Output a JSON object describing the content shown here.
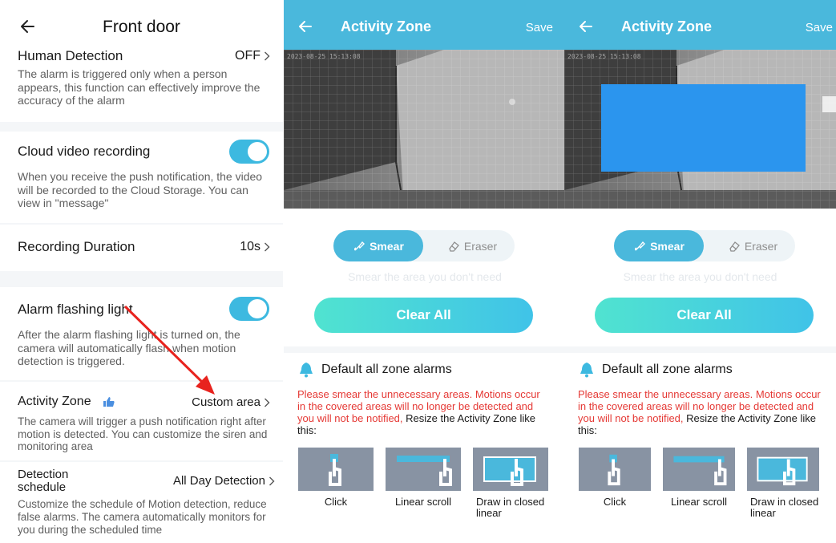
{
  "panel1": {
    "title": "Front door",
    "human_detection": {
      "label": "Human Detection",
      "value": "OFF",
      "desc": "The alarm is triggered only when a person appears, this function can effectively improve the accuracy of the alarm"
    },
    "cloud_recording": {
      "label": "Cloud video recording",
      "enabled": true,
      "desc": "When you receive the push notification, the video will be recorded to the Cloud Storage. You can view in \"message\""
    },
    "recording_duration": {
      "label": "Recording Duration",
      "value": "10s"
    },
    "alarm_light": {
      "label": "Alarm flashing light",
      "enabled": true,
      "desc": "After the alarm flashing light is turned on, the camera will automatically flash when motion detection is triggered."
    },
    "activity_zone": {
      "label": "Activity Zone",
      "value": "Custom area",
      "desc": "The camera will trigger a push notification right after motion is detected. You can customize the siren and monitoring area"
    },
    "detection_schedule": {
      "label_line1": "Detection",
      "label_line2": "schedule",
      "value": "All Day Detection",
      "desc": "Customize the schedule of Motion detection, reduce false alarms. The camera automatically monitors for you during the scheduled time"
    }
  },
  "zone_panels": [
    {
      "title": "Activity Zone",
      "save": "Save",
      "timestamp": "2023-08-25 15:13:08",
      "smear": "Smear",
      "eraser": "Eraser",
      "hint": "Smear the area you don't need",
      "clear_all": "Clear All",
      "alarm_text": "Default all zone alarms",
      "warning_red": "Please smear the unnecessary areas. Motions occur in the covered areas will no longer be detected and you will not be notified,",
      "warning_black": " Resize the Activity Zone like this:",
      "examples": [
        "Click",
        "Linear scroll",
        "Draw in closed linear"
      ]
    },
    {
      "title": "Activity Zone",
      "save": "Save",
      "timestamp": "2023-08-25 15:13:08",
      "smear": "Smear",
      "eraser": "Eraser",
      "hint": "Smear the area you don't need",
      "clear_all": "Clear All",
      "alarm_text": "Default all zone alarms",
      "warning_red": "Please smear the unnecessary areas. Motions occur in the covered areas will no longer be detected and you will not be notified,",
      "warning_black": " Resize the Activity Zone like this:",
      "examples": [
        "Click",
        "Linear scroll",
        "Draw in closed linear"
      ]
    }
  ],
  "colors": {
    "accent": "#4ab8dc",
    "toggle_on": "#3db9e0",
    "mask_blue": "#2b95ee",
    "warning_red": "#e53935",
    "arrow_red": "#e8231e"
  }
}
